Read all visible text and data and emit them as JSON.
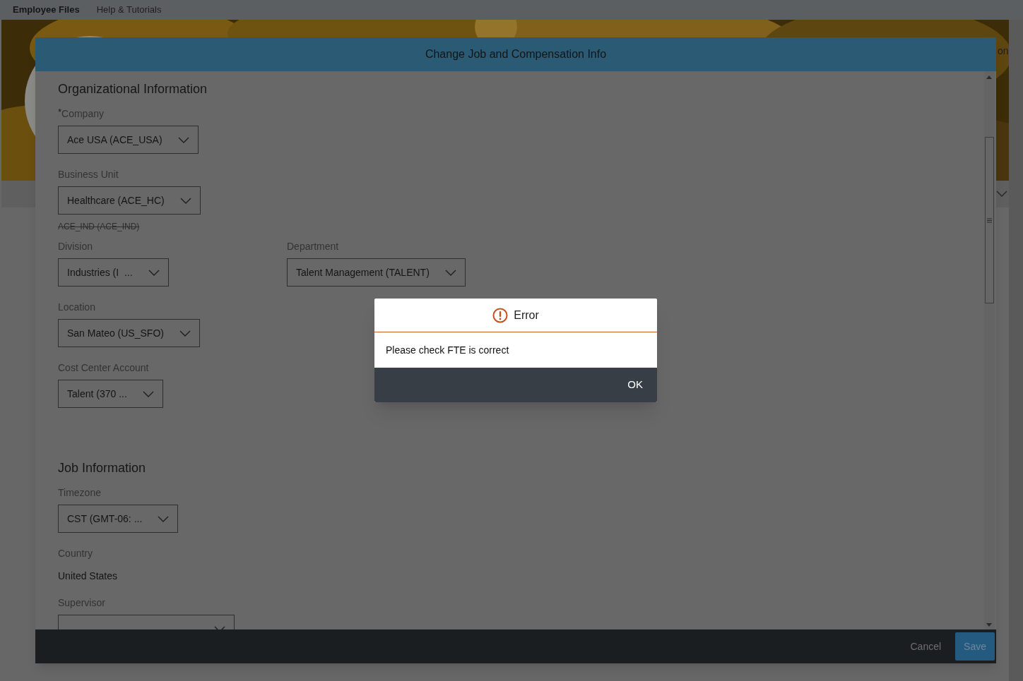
{
  "top_bar": {
    "title": "Employee Files",
    "links": [
      "Help & Tutorials"
    ]
  },
  "background_page": {
    "header_fragment": "on"
  },
  "modal": {
    "title": "Change Job and Compensation Info",
    "sections": [
      {
        "title": "Organizational Information",
        "rows": [
          [
            {
              "label": "$^{*}$Company",
              "kind": "select",
              "value": "Ace USA (ACE_USA)"
            }
          ],
          [
            {
              "label": "Business Unit",
              "kind": "select",
              "value": "Healthcare (ACE_HC)",
              "previous_value": "ACE_IND (ACE_IND)"
            }
          ],
          [
            {
              "label": "Division",
              "kind": "select",
              "value": "Industries (I  ..."
            },
            {
              "label": "Department",
              "kind": "select",
              "value": "Talent Management (TALENT)"
            }
          ],
          [
            {
              "label": "Location",
              "kind": "select",
              "value": "San Mateo (US_SFO)"
            }
          ],
          [
            {
              "label": "Cost Center Account",
              "kind": "select",
              "value": "Talent (370 ..."
            }
          ]
        ]
      },
      {
        "title": "Job Information",
        "rows": [
          [
            {
              "label": "Timezone",
              "kind": "select",
              "value": "CST (GMT-06: ..."
            }
          ],
          [
            {
              "label": "Country",
              "kind": "text",
              "value": "United States"
            }
          ],
          [
            {
              "label": "Supervisor",
              "kind": "select"
            }
          ]
        ]
      }
    ],
    "buttons": [
      {
        "label": "Cancel",
        "kind": "secondary"
      },
      {
        "label": "Save",
        "kind": "primary"
      }
    ]
  },
  "error_dialog": {
    "title": "Error",
    "message": "Please check FTE is correct",
    "buttons": [
      "OK"
    ]
  }
}
